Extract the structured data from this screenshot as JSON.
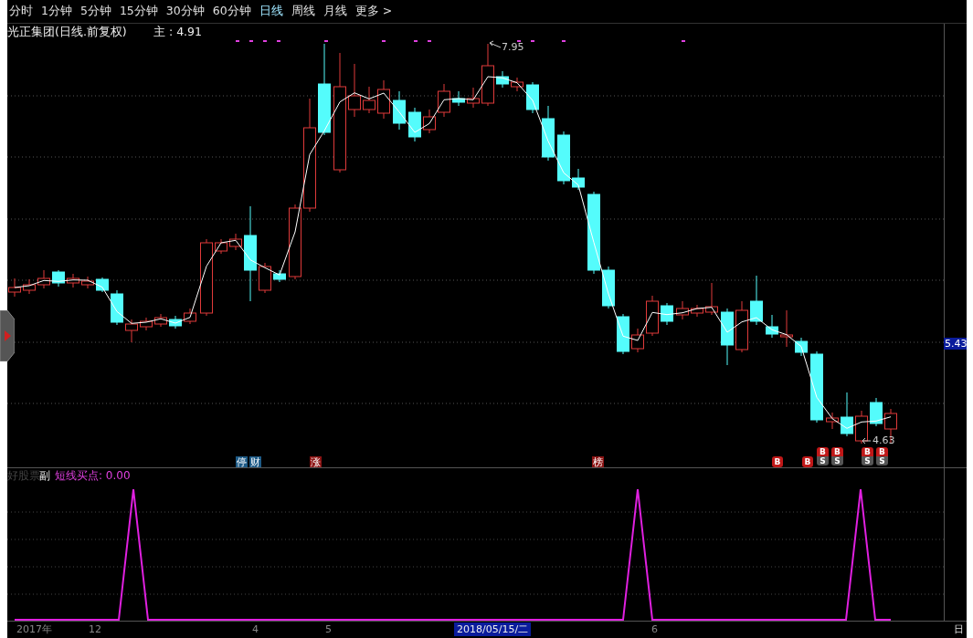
{
  "toolbar": {
    "tabs": [
      {
        "label": "分时",
        "selected": false
      },
      {
        "label": "1分钟",
        "selected": false
      },
      {
        "label": "5分钟",
        "selected": false
      },
      {
        "label": "15分钟",
        "selected": false
      },
      {
        "label": "30分钟",
        "selected": false
      },
      {
        "label": "60分钟",
        "selected": false
      },
      {
        "label": "日线",
        "selected": true
      },
      {
        "label": "周线",
        "selected": false
      },
      {
        "label": "月线",
        "selected": false
      },
      {
        "label": "更多",
        "selected": false
      }
    ],
    "more_arrow": ">"
  },
  "main_panel": {
    "title": "光正集团(日线.前复权)",
    "indicator": "主 : 4.91",
    "high_label": "7.95",
    "low_label": "4.63",
    "price_marker": "5.43"
  },
  "markers": [
    {
      "label": "停",
      "kind": "tag",
      "color": "#1d5a86"
    },
    {
      "label": "财",
      "kind": "tag",
      "color": "#1d5a86"
    },
    {
      "label": "涨",
      "kind": "tag",
      "color": "#8c1414"
    },
    {
      "label": "榜",
      "kind": "tag",
      "color": "#8c1414"
    },
    {
      "label": "B",
      "kind": "round"
    },
    {
      "label": "B",
      "kind": "round"
    },
    {
      "label": "B",
      "label_2": "S",
      "kind": "stack"
    },
    {
      "label": "B",
      "label_2": "S",
      "kind": "stack"
    },
    {
      "label": "B",
      "label_2": "S",
      "kind": "stack"
    },
    {
      "label": "B",
      "label_2": "S",
      "kind": "stack"
    }
  ],
  "sub_panel": {
    "name": "好股票",
    "pane": "副",
    "indicator": "短线买点: 0.00"
  },
  "time_axis": {
    "labels": [
      "2017年",
      "12",
      "4",
      "5",
      "6"
    ],
    "cursor_date": "2018/05/15/二",
    "period": "日"
  }
}
